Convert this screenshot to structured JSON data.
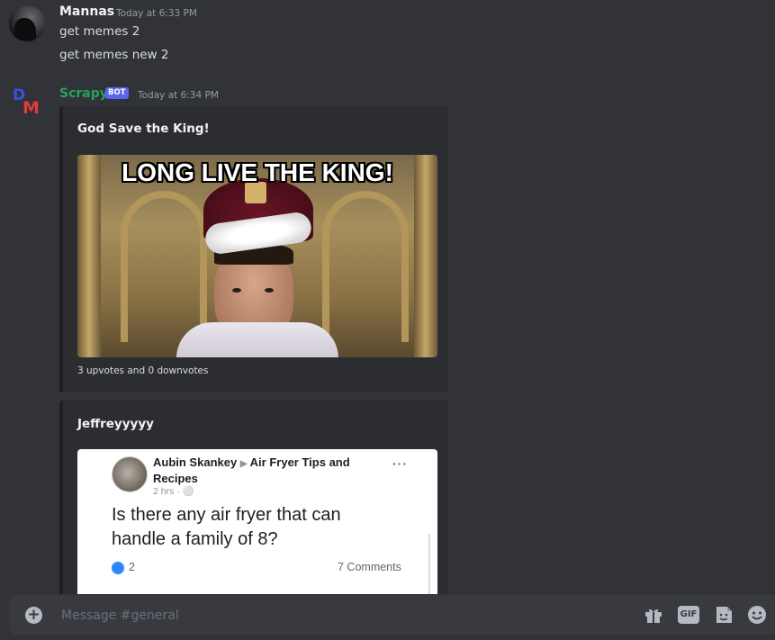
{
  "messages": {
    "first": {
      "username": "Mannas",
      "timestamp": "Today at 6:33 PM",
      "lines": [
        "get memes 2",
        "get memes new 2"
      ]
    },
    "bot": {
      "username": "Scrapy",
      "bot_tag": "BOT",
      "timestamp": "Today at 6:34 PM",
      "avatar_letters": [
        "D",
        "M"
      ]
    }
  },
  "embeds": [
    {
      "title": "God Save the King!",
      "image_caption": "LONG LIVE THE KING!",
      "footer": "3 upvotes and 0 downvotes"
    },
    {
      "title": "Jeffreyyyyy",
      "post": {
        "author": "Aubin Skankey",
        "group": "Air Fryer Tips and Recipes",
        "meta": "2 hrs · ",
        "text": "Is there any air fryer that can handle a family of 8?",
        "likes": "2",
        "comments": "7 Comments",
        "menu": "···"
      }
    }
  ],
  "composer": {
    "placeholder": "Message #general",
    "plus": "+",
    "gif_label": "GIF"
  },
  "colors": {
    "background": "#313338",
    "embed_bg": "#2b2d31",
    "bot_name": "#23a55a",
    "bot_tag": "#5865f2",
    "user_name": "#f2f3f5"
  }
}
